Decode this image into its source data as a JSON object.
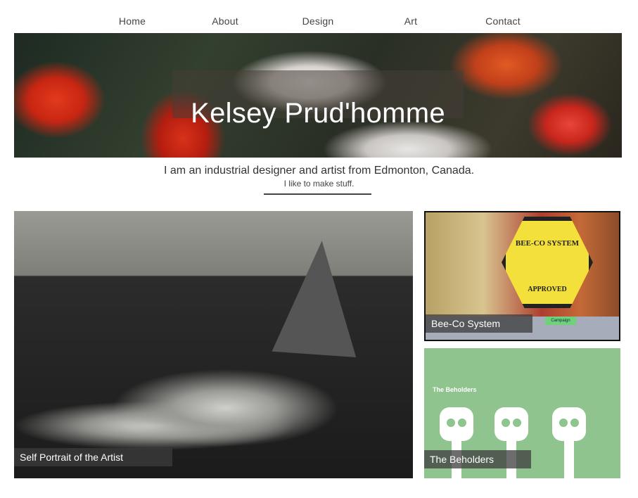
{
  "nav": {
    "items": [
      "Home",
      "About",
      "Design",
      "Art",
      "Contact"
    ]
  },
  "hero": {
    "title": "Kelsey Prud'homme"
  },
  "intro": {
    "line1": "I am an industrial designer and artist from Edmonton, Canada.",
    "line2": "I like to make stuff."
  },
  "portfolio": {
    "items": [
      {
        "caption": "Self Portrait of the Artist"
      },
      {
        "caption": "Bee-Co System",
        "badge_line1": "BEE-CO SYSTEM",
        "badge_line2": "APPROVED",
        "tag": "Campaign"
      },
      {
        "caption": "The Beholders",
        "inner_title": "The Beholders"
      }
    ]
  },
  "colors": {
    "tile_green": "#8fc48f",
    "badge_yellow": "#f3e03a",
    "caption_bg": "#3c3c3c"
  }
}
